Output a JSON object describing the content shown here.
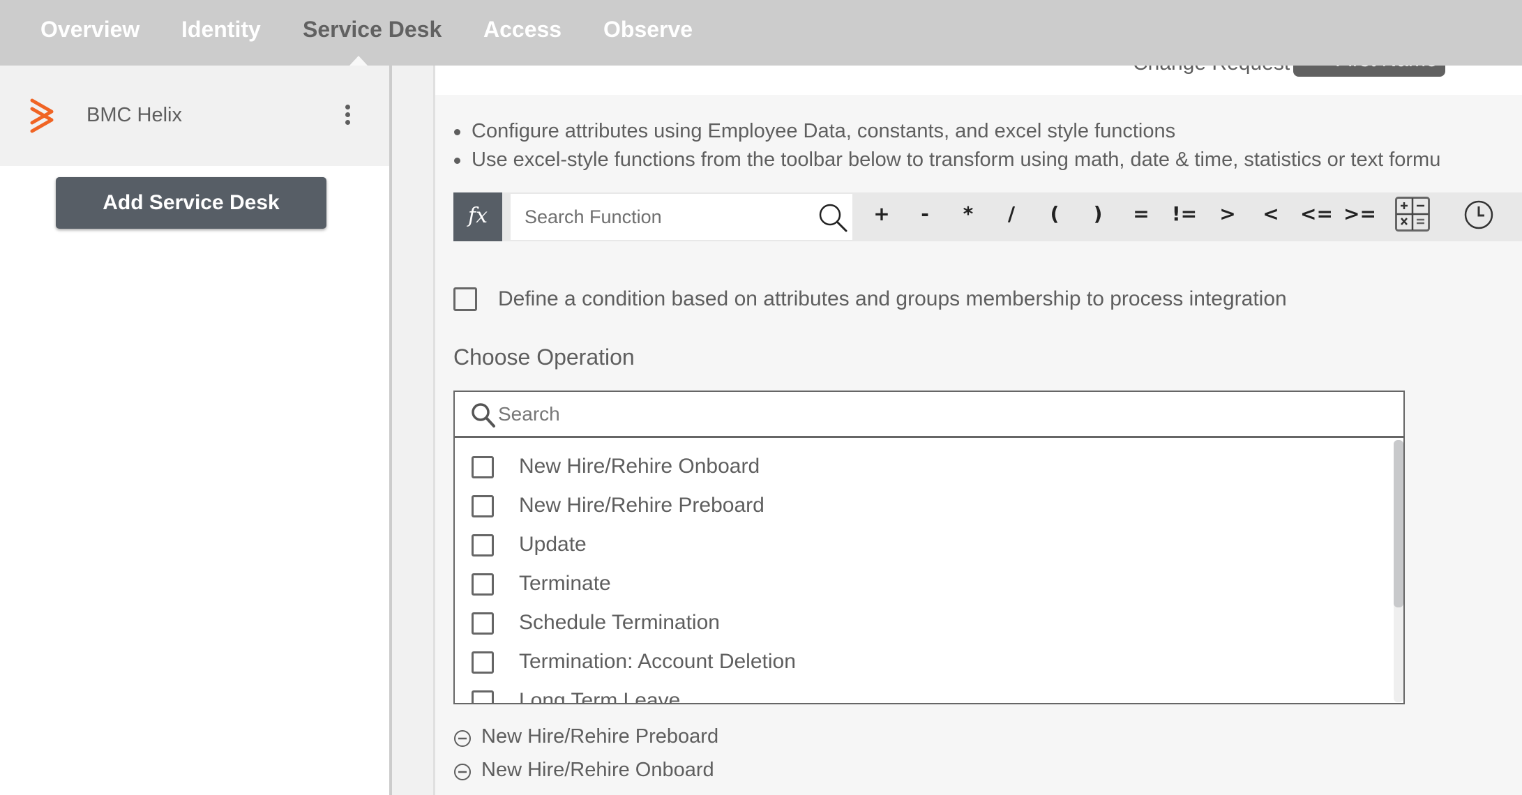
{
  "topnav": {
    "tabs": [
      {
        "label": "Overview",
        "active": false
      },
      {
        "label": "Identity",
        "active": false
      },
      {
        "label": "Service Desk",
        "active": true
      },
      {
        "label": "Access",
        "active": false
      },
      {
        "label": "Observe",
        "active": false
      }
    ]
  },
  "sidebar": {
    "provider_name": "BMC Helix",
    "logo_color": "#f06424",
    "add_button_label": "Add Service Desk"
  },
  "main": {
    "partial_header": {
      "label": "Change Request",
      "select_value": "First Name"
    },
    "bullets": [
      "Configure attributes using Employee Data, constants, and excel style functions",
      "Use excel-style functions from the toolbar below to transform using math, date & time, statistics or text formu"
    ],
    "toolbar": {
      "fx_label": "fx",
      "search_placeholder": "Search Function",
      "operators": [
        "+",
        "-",
        "*",
        "/",
        "(",
        ")",
        "=",
        "!=",
        ">",
        "<",
        "<=",
        ">="
      ]
    },
    "condition": {
      "label": "Define a condition based on attributes and groups membership to process integration",
      "checked": false
    },
    "choose_operation": {
      "title": "Choose Operation",
      "search_placeholder": "Search",
      "options": [
        {
          "label": "New Hire/Rehire Onboard",
          "checked": false
        },
        {
          "label": "New Hire/Rehire Preboard",
          "checked": false
        },
        {
          "label": "Update",
          "checked": false
        },
        {
          "label": "Terminate",
          "checked": false
        },
        {
          "label": "Schedule Termination",
          "checked": false
        },
        {
          "label": "Termination: Account Deletion",
          "checked": false
        },
        {
          "label": "Long Term Leave",
          "checked": false
        }
      ],
      "selected": [
        "New Hire/Rehire Preboard",
        "New Hire/Rehire Onboard"
      ]
    }
  }
}
